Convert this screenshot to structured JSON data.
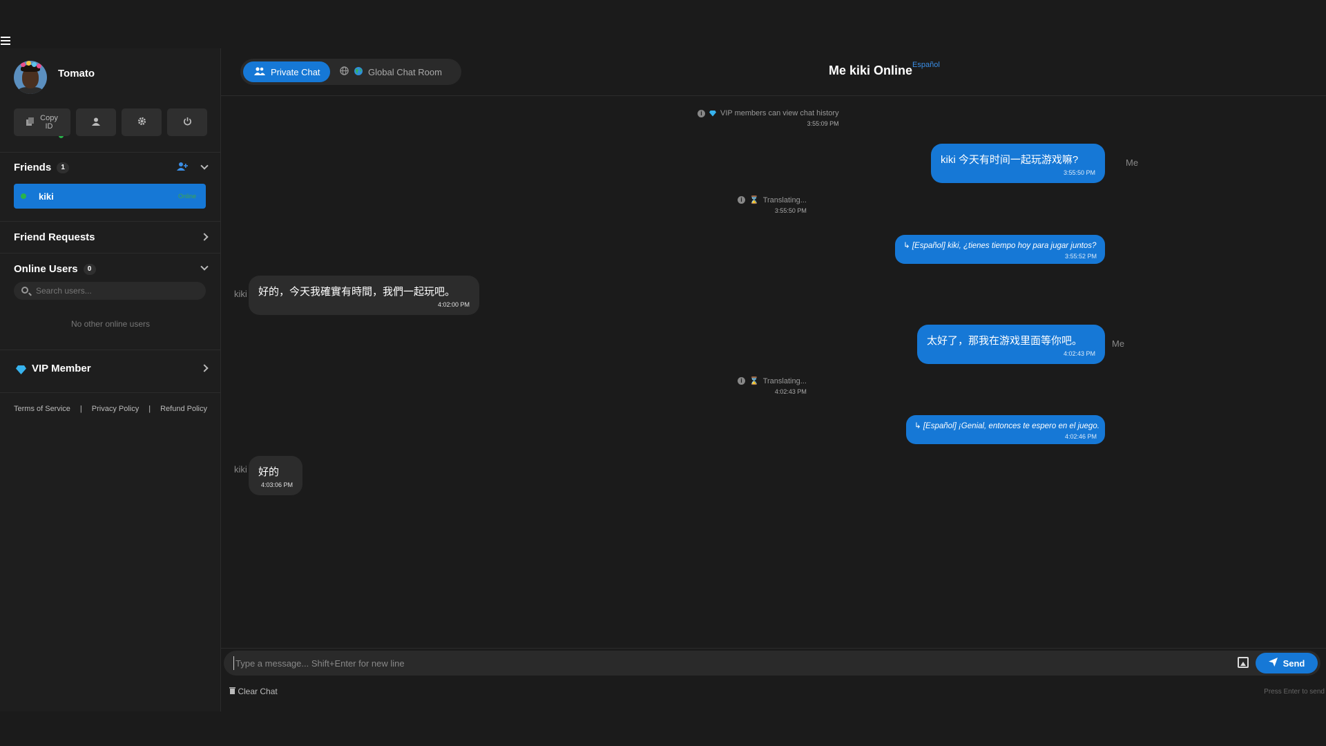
{
  "profile": {
    "name": "Tomato"
  },
  "profile_buttons": {
    "copy_id": "Copy\nID"
  },
  "friends": {
    "title": "Friends",
    "count": "1",
    "items": [
      {
        "name": "kiki",
        "status": "Online"
      }
    ]
  },
  "friend_requests": {
    "title": "Friend Requests"
  },
  "online_users": {
    "title": "Online Users",
    "count": "0",
    "search_placeholder": "Search users...",
    "empty_text": "No other online users"
  },
  "vip": {
    "title": "VIP Member"
  },
  "footer": {
    "terms": "Terms of Service",
    "privacy": "Privacy Policy",
    "refund": "Refund Policy",
    "sep": "|"
  },
  "tabs": {
    "private": "Private Chat",
    "global": "Global Chat Room"
  },
  "chat": {
    "title": "Me kiki Online",
    "language": "Español"
  },
  "messages": {
    "sys1": {
      "text": "VIP members can view chat history",
      "time": "3:55:09 PM"
    },
    "m1": {
      "sender": "Me",
      "text": "kiki 今天有时间一起玩游戏嘛?",
      "time": "3:55:50 PM"
    },
    "sys2": {
      "text": "Translating...",
      "time": "3:55:50 PM"
    },
    "m2": {
      "text": "↳ [Español] kiki, ¿tienes tiempo hoy para jugar juntos?",
      "time": "3:55:52 PM"
    },
    "m3": {
      "sender": "kiki",
      "text": "好的，今天我確實有時間，我們一起玩吧。",
      "time": "4:02:00 PM"
    },
    "m4": {
      "sender": "Me",
      "text": "太好了，那我在游戏里面等你吧。",
      "time": "4:02:43 PM"
    },
    "sys3": {
      "text": "Translating...",
      "time": "4:02:43 PM"
    },
    "m5": {
      "text": "↳ [Español] ¡Genial, entonces te espero en el juego.",
      "time": "4:02:46 PM"
    },
    "m6": {
      "sender": "kiki",
      "text": "好的",
      "time": "4:03:06 PM"
    }
  },
  "composer": {
    "placeholder": "Type a message... Shift+Enter for new line",
    "send": "Send",
    "clear": "Clear Chat",
    "hint": "Press Enter to send"
  },
  "colors": {
    "accent": "#1678d6",
    "online": "#29b34a",
    "background": "#1b1b1b",
    "sidebar": "#1e1e1e"
  },
  "icons": {
    "menu": "hamburger-icon",
    "copy": "copy-icon",
    "profile": "user-icon",
    "settings": "gear-icon",
    "logout": "power-icon",
    "add_friend": "add-user-icon",
    "search": "search-icon",
    "vip": "diamond-icon",
    "private_tab": "users-icon",
    "global_tab": "globe-icon",
    "info": "info-icon",
    "translating": "hourglass-icon",
    "image": "image-icon",
    "send": "paper-plane-icon"
  }
}
